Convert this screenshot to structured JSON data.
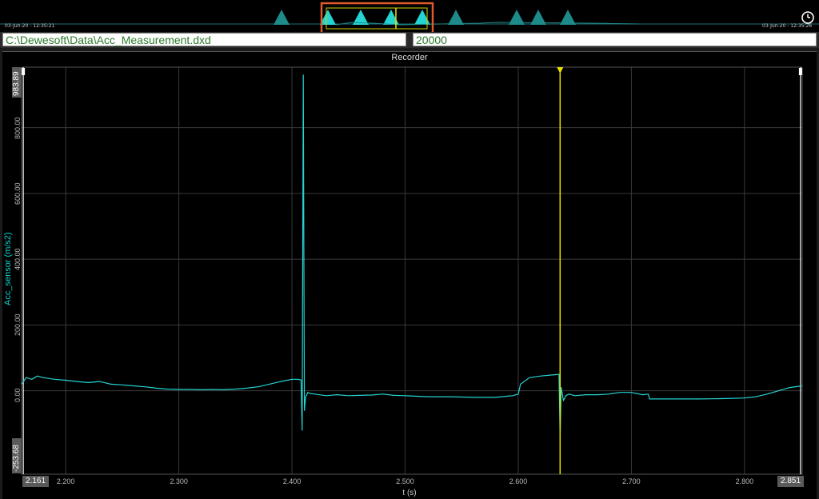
{
  "overview": {
    "start_time": "03-Jun-20 - 12:35:21",
    "end_time": "03-Jun-20 - 12:35:26",
    "clock_icon": "clock-icon"
  },
  "infobar": {
    "file_path": "C:\\Dewesoft\\Data\\Acc_Measurement.dxd",
    "sample_rate": "20000"
  },
  "recorder": {
    "title": "Recorder",
    "y_axis_label": "Acc_sensor (m/s2)",
    "x_axis_label": "t (s)",
    "y_max_label": "983.89",
    "y_min_label": "-253.68",
    "x_start_label": "2.161",
    "x_end_label": "2.851",
    "y_ticks": [
      "0.00",
      "200.00",
      "400.00",
      "600.00",
      "800.00"
    ],
    "x_ticks": [
      "2.200",
      "2.300",
      "2.400",
      "2.500",
      "2.600",
      "2.700",
      "2.800"
    ],
    "cursor_time": 2.637,
    "signal_color": "#25d3d3",
    "cursor_color": "#e8e000",
    "highlight_color": "#e35a2a"
  },
  "chart_data": {
    "type": "line",
    "title": "Recorder",
    "xlabel": "t (s)",
    "ylabel": "Acc_sensor (m/s2)",
    "xlim": [
      2.161,
      2.851
    ],
    "ylim": [
      -253.68,
      983.89
    ],
    "grid": true,
    "series": [
      {
        "x": [
          2.161,
          2.165,
          2.17,
          2.175,
          2.18,
          2.19,
          2.2,
          2.21,
          2.22,
          2.23,
          2.24,
          2.25,
          2.26,
          2.27,
          2.28,
          2.29,
          2.3,
          2.31,
          2.32,
          2.33,
          2.34,
          2.35,
          2.36,
          2.37,
          2.38,
          2.39,
          2.4,
          2.405,
          2.408,
          2.409,
          2.41,
          2.411,
          2.412,
          2.414,
          2.416,
          2.42,
          2.43,
          2.44,
          2.45,
          2.46,
          2.47,
          2.48,
          2.49,
          2.5,
          2.52,
          2.54,
          2.56,
          2.58,
          2.595,
          2.6,
          2.602,
          2.61,
          2.62,
          2.63,
          2.636,
          2.637,
          2.638,
          2.64,
          2.642,
          2.645,
          2.65,
          2.66,
          2.67,
          2.68,
          2.69,
          2.7,
          2.71,
          2.715,
          2.716,
          2.72,
          2.74,
          2.76,
          2.78,
          2.8,
          2.81,
          2.82,
          2.83,
          2.84,
          2.851
        ],
        "y": [
          20,
          40,
          35,
          45,
          40,
          35,
          32,
          28,
          25,
          28,
          20,
          18,
          15,
          12,
          8,
          5,
          4,
          4,
          3,
          4,
          3,
          5,
          8,
          12,
          20,
          28,
          35,
          35,
          33,
          -120,
          960,
          -60,
          -20,
          -5,
          -8,
          -10,
          -15,
          -12,
          -15,
          -14,
          -13,
          -10,
          -14,
          -15,
          -18,
          -18,
          -20,
          -20,
          -15,
          -10,
          20,
          40,
          45,
          48,
          50,
          -140,
          10,
          -30,
          -15,
          -10,
          -15,
          -12,
          -12,
          -10,
          -5,
          -5,
          -12,
          -10,
          -25,
          -25,
          -25,
          -25,
          -24,
          -22,
          -18,
          -10,
          0,
          10,
          15
        ]
      }
    ]
  }
}
